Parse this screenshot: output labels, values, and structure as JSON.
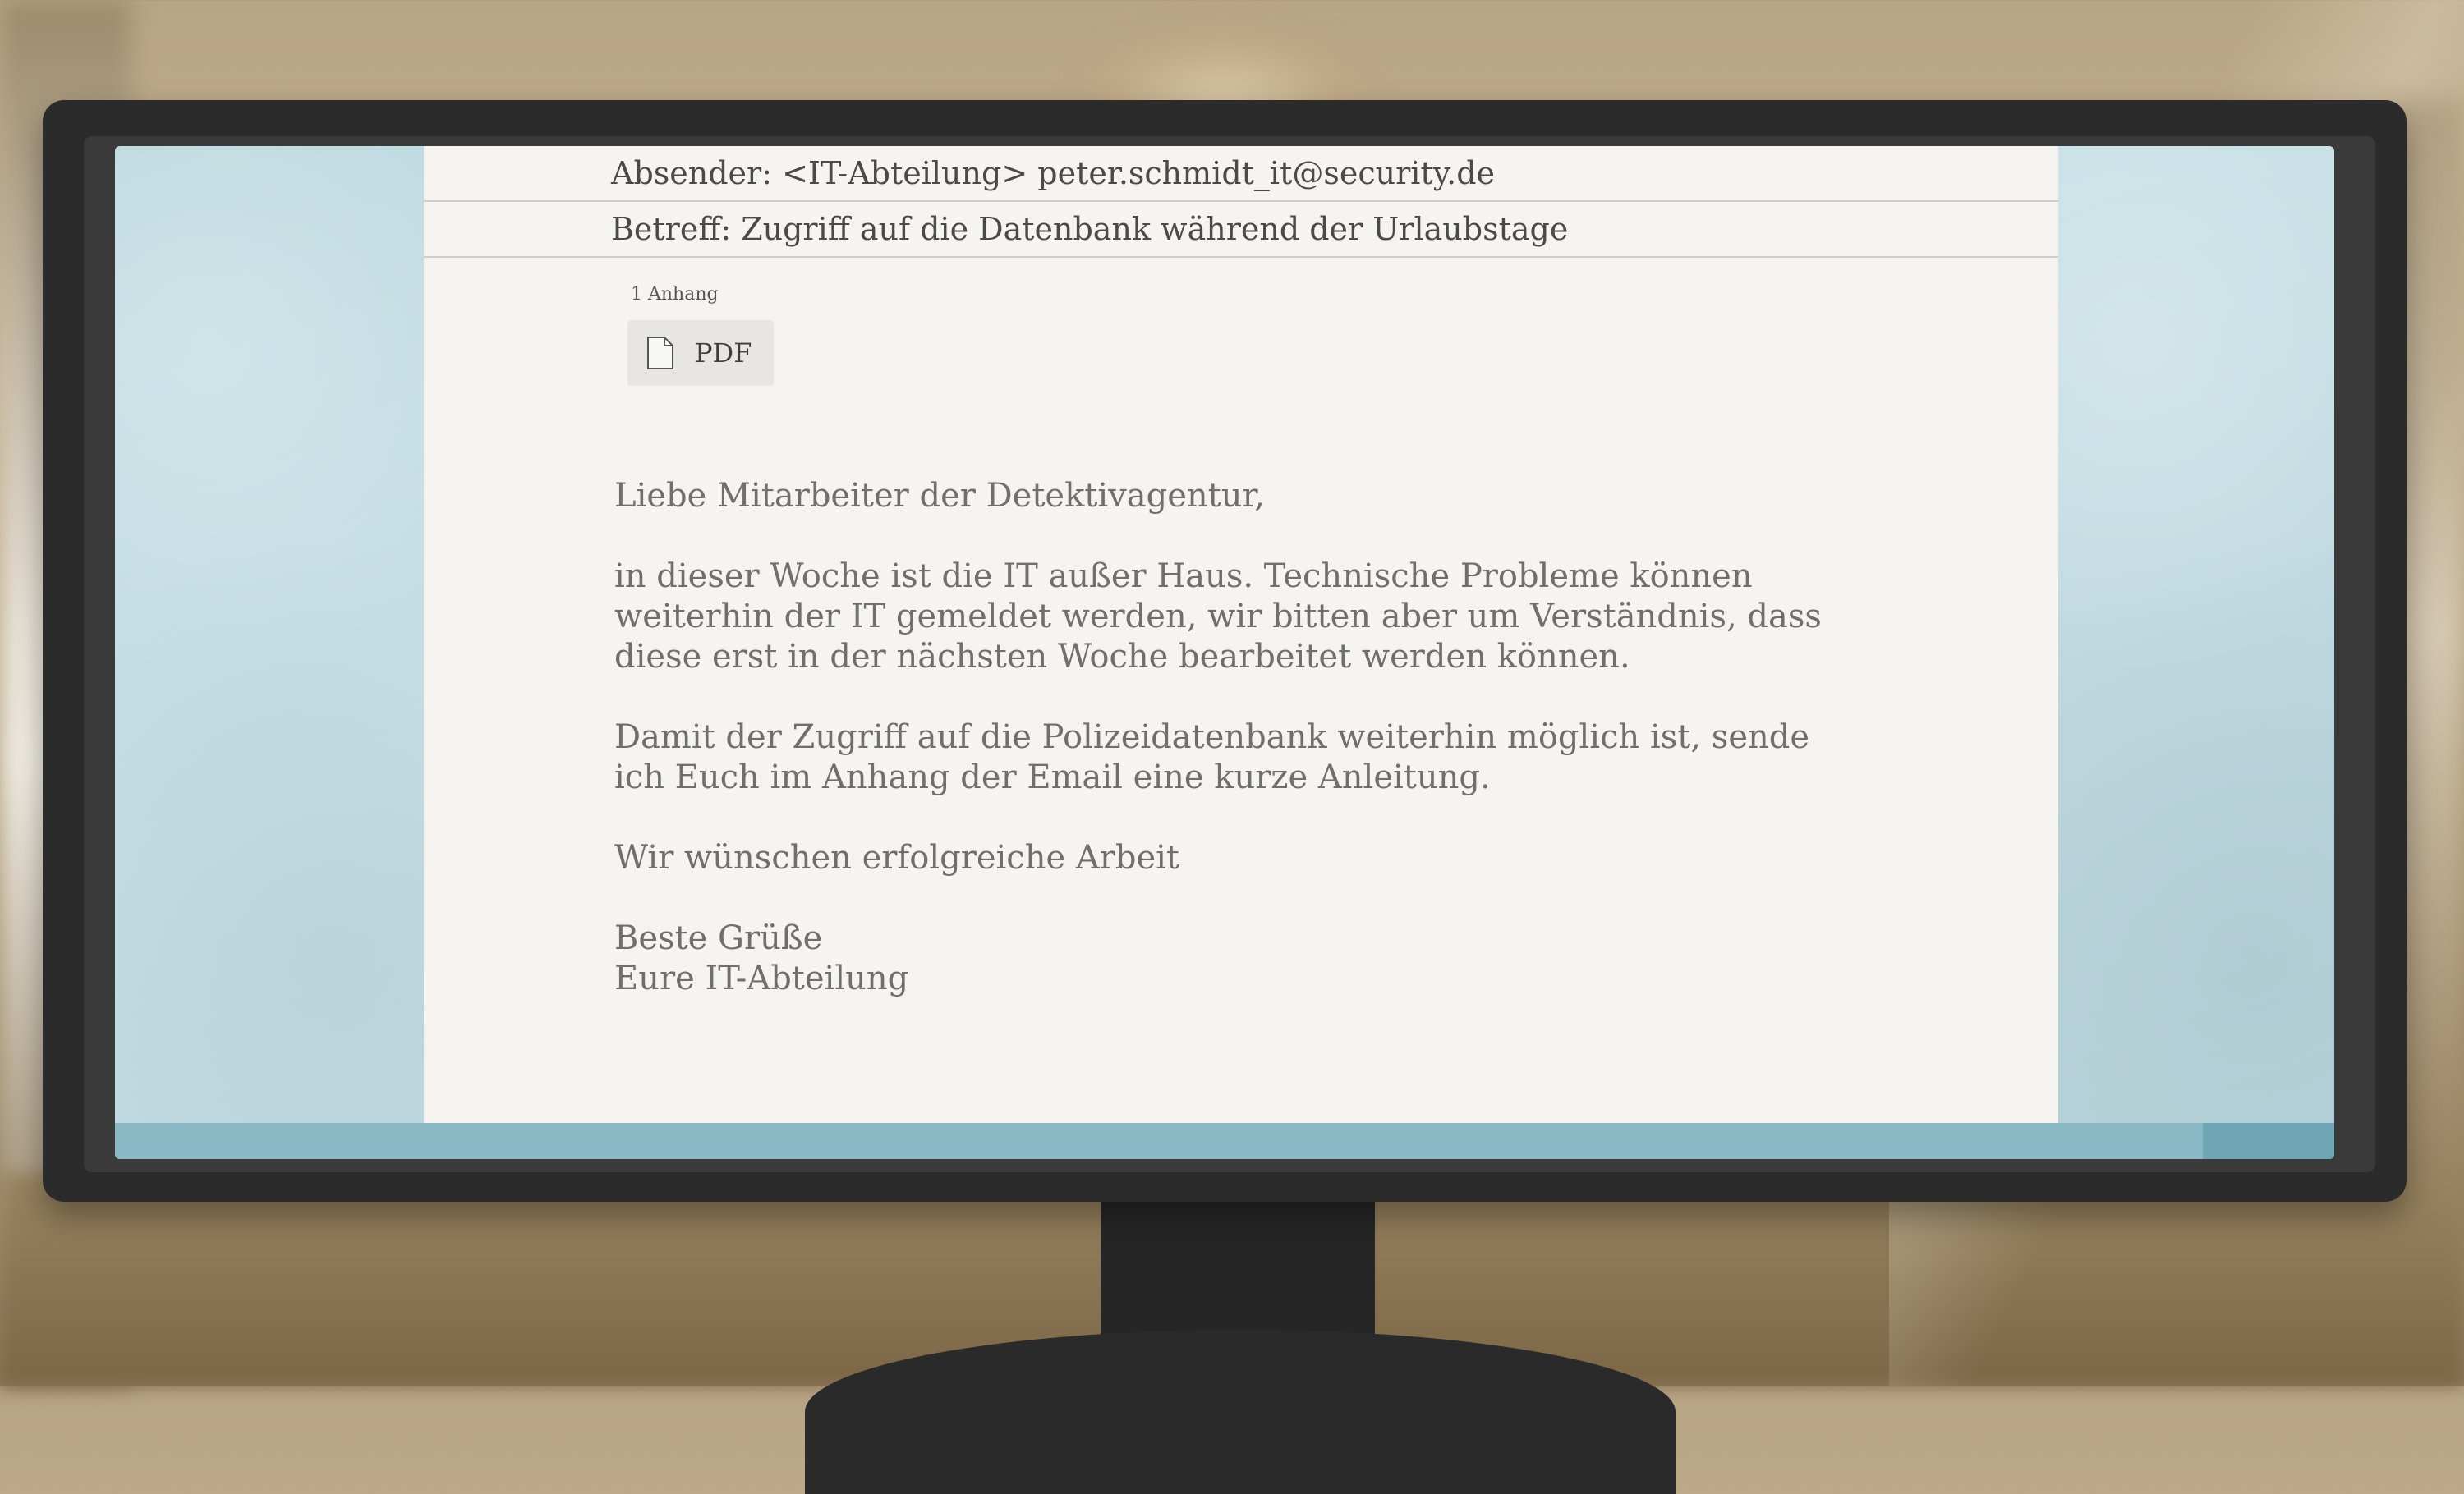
{
  "email": {
    "sender": "Absender: <IT-Abteilung> peter.schmidt_it@security.de",
    "subject": "Betreff: Zugriff auf die Datenbank während der Urlaubstage",
    "attachments": {
      "count_label": "1 Anhang",
      "items": [
        {
          "type_label": "PDF",
          "icon": "file-icon"
        }
      ]
    },
    "body": {
      "greeting": "Liebe Mitarbeiter der Detektivagentur,",
      "paragraph_1": "in dieser Woche ist die IT außer Haus. Technische Probleme können\nweiterhin der IT gemeldet werden, wir bitten aber um Verständnis, dass\ndiese erst in der nächsten Woche bearbeitet werden können.",
      "paragraph_2": "Damit der Zugriff auf die Polizeidatenbank weiterhin möglich ist, sende\nich Euch im Anhang der Email eine kurze Anleitung.",
      "paragraph_3": "Wir wünschen erfolgreiche Arbeit",
      "signoff": "Beste Grüße\nEure IT-Abteilung"
    }
  },
  "colors": {
    "screen_background": "#c4dde3",
    "email_background": "#f5f4f1",
    "taskbar": "#8ab8c4",
    "monitor_bezel": "#2b2b2b",
    "text": "#4a4a48"
  }
}
